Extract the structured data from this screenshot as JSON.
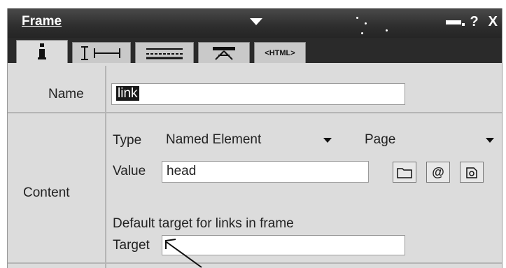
{
  "window": {
    "title": "Frame",
    "controls": {
      "help": "?",
      "close": "X"
    }
  },
  "tabs": [
    {
      "name": "general",
      "icon": "info-icon"
    },
    {
      "name": "size-position",
      "icon": "resize-icon"
    },
    {
      "name": "borders",
      "icon": "lines-icon"
    },
    {
      "name": "frameset",
      "icon": "frame-icon"
    },
    {
      "name": "html",
      "label": "<HTML>"
    }
  ],
  "form": {
    "name_label": "Name",
    "name_value": "link",
    "content_label": "Content",
    "type_label": "Type",
    "type_value": "Named Element",
    "type_scope_value": "Page",
    "value_label": "Value",
    "value_value": "head",
    "default_target_heading": "Default target for links in frame",
    "target_label": "Target",
    "target_value": ""
  },
  "buttons": {
    "at_label": "@"
  }
}
